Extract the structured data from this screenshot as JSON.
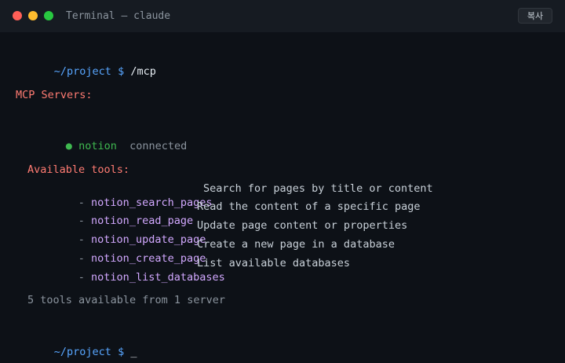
{
  "window": {
    "title": "Terminal — claude",
    "copy_label": "복사"
  },
  "prompt": {
    "path": "~/project",
    "symbol": "$",
    "command": "/mcp",
    "cursor": "_"
  },
  "mcp": {
    "heading": "MCP Servers:",
    "server": {
      "bullet": "●",
      "name": "notion",
      "status": "connected"
    },
    "tools_heading": "Available tools:",
    "tools": [
      {
        "name": "notion_search_pages",
        "description": "Search for pages by title or content"
      },
      {
        "name": "notion_read_page",
        "description": "Read the content of a specific page"
      },
      {
        "name": "notion_update_page",
        "description": "Update page content or properties"
      },
      {
        "name": "notion_create_page",
        "description": "Create a new page in a database"
      },
      {
        "name": "notion_list_databases",
        "description": "List available databases"
      }
    ],
    "summary": "5 tools available from 1 server"
  },
  "colors": {
    "background": "#0d1117",
    "titlebar": "#161b22",
    "prompt": "#58a6ff",
    "heading": "#ff7b72",
    "connected": "#3fb950",
    "tool_name": "#d2a8ff",
    "muted": "#8b949e"
  }
}
